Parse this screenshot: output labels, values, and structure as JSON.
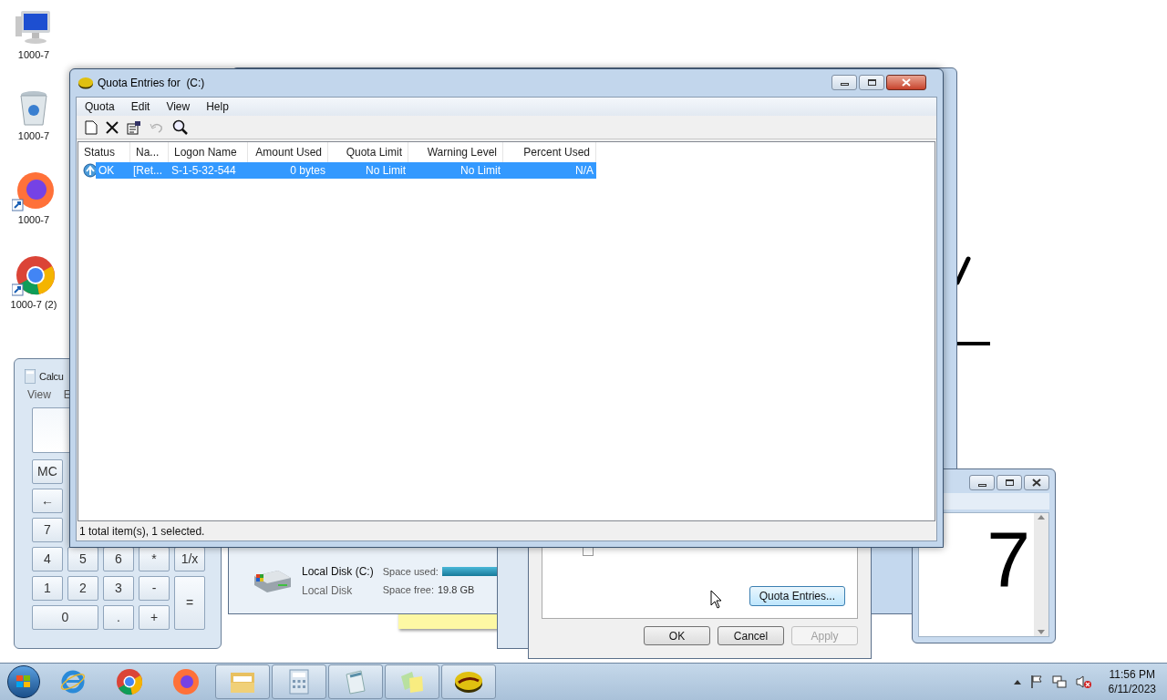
{
  "desktop_icons": [
    {
      "kind": "computer",
      "label": "1000-7"
    },
    {
      "kind": "recycle",
      "label": "1000-7"
    },
    {
      "kind": "firefox",
      "label": "1000-7"
    },
    {
      "kind": "chrome",
      "label": "1000-7 (2)"
    }
  ],
  "calculator": {
    "title": "Calcu",
    "menu": [
      "View",
      "E"
    ],
    "buttons": [
      "MC",
      "←",
      "7",
      "4",
      "5",
      "6",
      "*",
      "1/x",
      "1",
      "2",
      "3",
      "-",
      "=",
      "0",
      ".",
      "+"
    ]
  },
  "explorer": {
    "drive_name": "Local Disk (C:)",
    "drive_type": "Local Disk",
    "space_used_label": "Space used:",
    "space_free_label": "Space free:",
    "space_free": "19.8 GB"
  },
  "properties_dialog": {
    "log_checkbox_checked": false,
    "quota_entries_button": "Quota Entries...",
    "buttons": [
      {
        "label": "OK",
        "disabled": false
      },
      {
        "label": "Cancel",
        "disabled": false
      },
      {
        "label": "Apply",
        "disabled": true
      }
    ]
  },
  "notepad": {
    "text": "7"
  },
  "quota_window": {
    "title": "Quota Entries for  (C:)",
    "menu": [
      "Quota",
      "Edit",
      "View",
      "Help"
    ],
    "toolbar": [
      {
        "kind": "new",
        "disabled": false
      },
      {
        "kind": "delete",
        "disabled": false
      },
      {
        "kind": "properties",
        "disabled": false
      },
      {
        "kind": "undo",
        "disabled": true
      },
      {
        "kind": "find",
        "disabled": false
      }
    ],
    "columns": [
      "Status",
      "Na...",
      "Logon Name",
      "Amount Used",
      "Quota Limit",
      "Warning Level",
      "Percent Used"
    ],
    "rows": [
      {
        "selected": true,
        "cells": [
          "OK",
          "[Ret...",
          "S-1-5-32-544",
          "0 bytes",
          "No Limit",
          "No Limit",
          "N/A"
        ]
      }
    ],
    "status_bar": "1 total item(s), 1 selected."
  },
  "taskbar": {
    "items": [
      {
        "kind": "ie",
        "framed": false
      },
      {
        "kind": "chrome",
        "framed": false
      },
      {
        "kind": "firefox",
        "framed": false
      },
      {
        "kind": "explorer",
        "framed": true
      },
      {
        "kind": "calculator",
        "framed": true
      },
      {
        "kind": "notepad",
        "framed": true
      },
      {
        "kind": "sticky",
        "framed": true
      },
      {
        "kind": "quota",
        "framed": true
      }
    ],
    "clock_time": "11:56 PM",
    "clock_date": "6/11/2023"
  }
}
